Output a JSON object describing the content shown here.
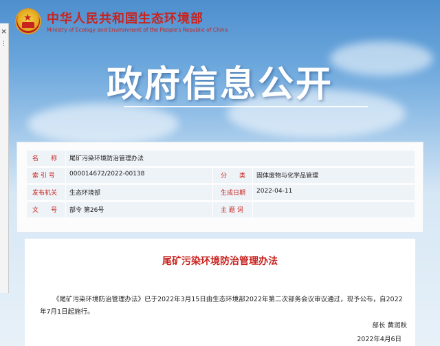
{
  "header": {
    "title": "中华人民共和国生态环境部",
    "subtitle": "Ministry of Ecology and Environment of the People's Republic of China"
  },
  "left_strip": {
    "close_glyph": "×",
    "dots_glyph": "⋮"
  },
  "banner": {
    "title": "政府信息公开"
  },
  "info": {
    "name_label": "名　　称",
    "name_value": "尾矿污染环境防治管理办法",
    "index_label": "索 引 号",
    "index_value": "000014672/2022-00138",
    "category_label": "分　　类",
    "category_value": "固体废物与化学品管理",
    "issuer_label": "发布机关",
    "issuer_value": "生态环境部",
    "date_label": "生成日期",
    "date_value": "2022-04-11",
    "docno_label": "文　　号",
    "docno_value": "部令 第26号",
    "keywords_label": "主 题 词",
    "keywords_value": ""
  },
  "content": {
    "title": "尾矿污染环境防治管理办法",
    "paragraph": "《尾矿污染环境防治管理办法》已于2022年3月15日由生态环境部2022年第二次部务会议审议通过，现予公布，自2022年7月1日起施行。",
    "signer": "部长 黄润秋",
    "sign_date": "2022年4月6日"
  },
  "colors": {
    "brand_red": "#c8241f",
    "row_bg": "#eef3f8",
    "sky_top": "#4e8fce"
  }
}
